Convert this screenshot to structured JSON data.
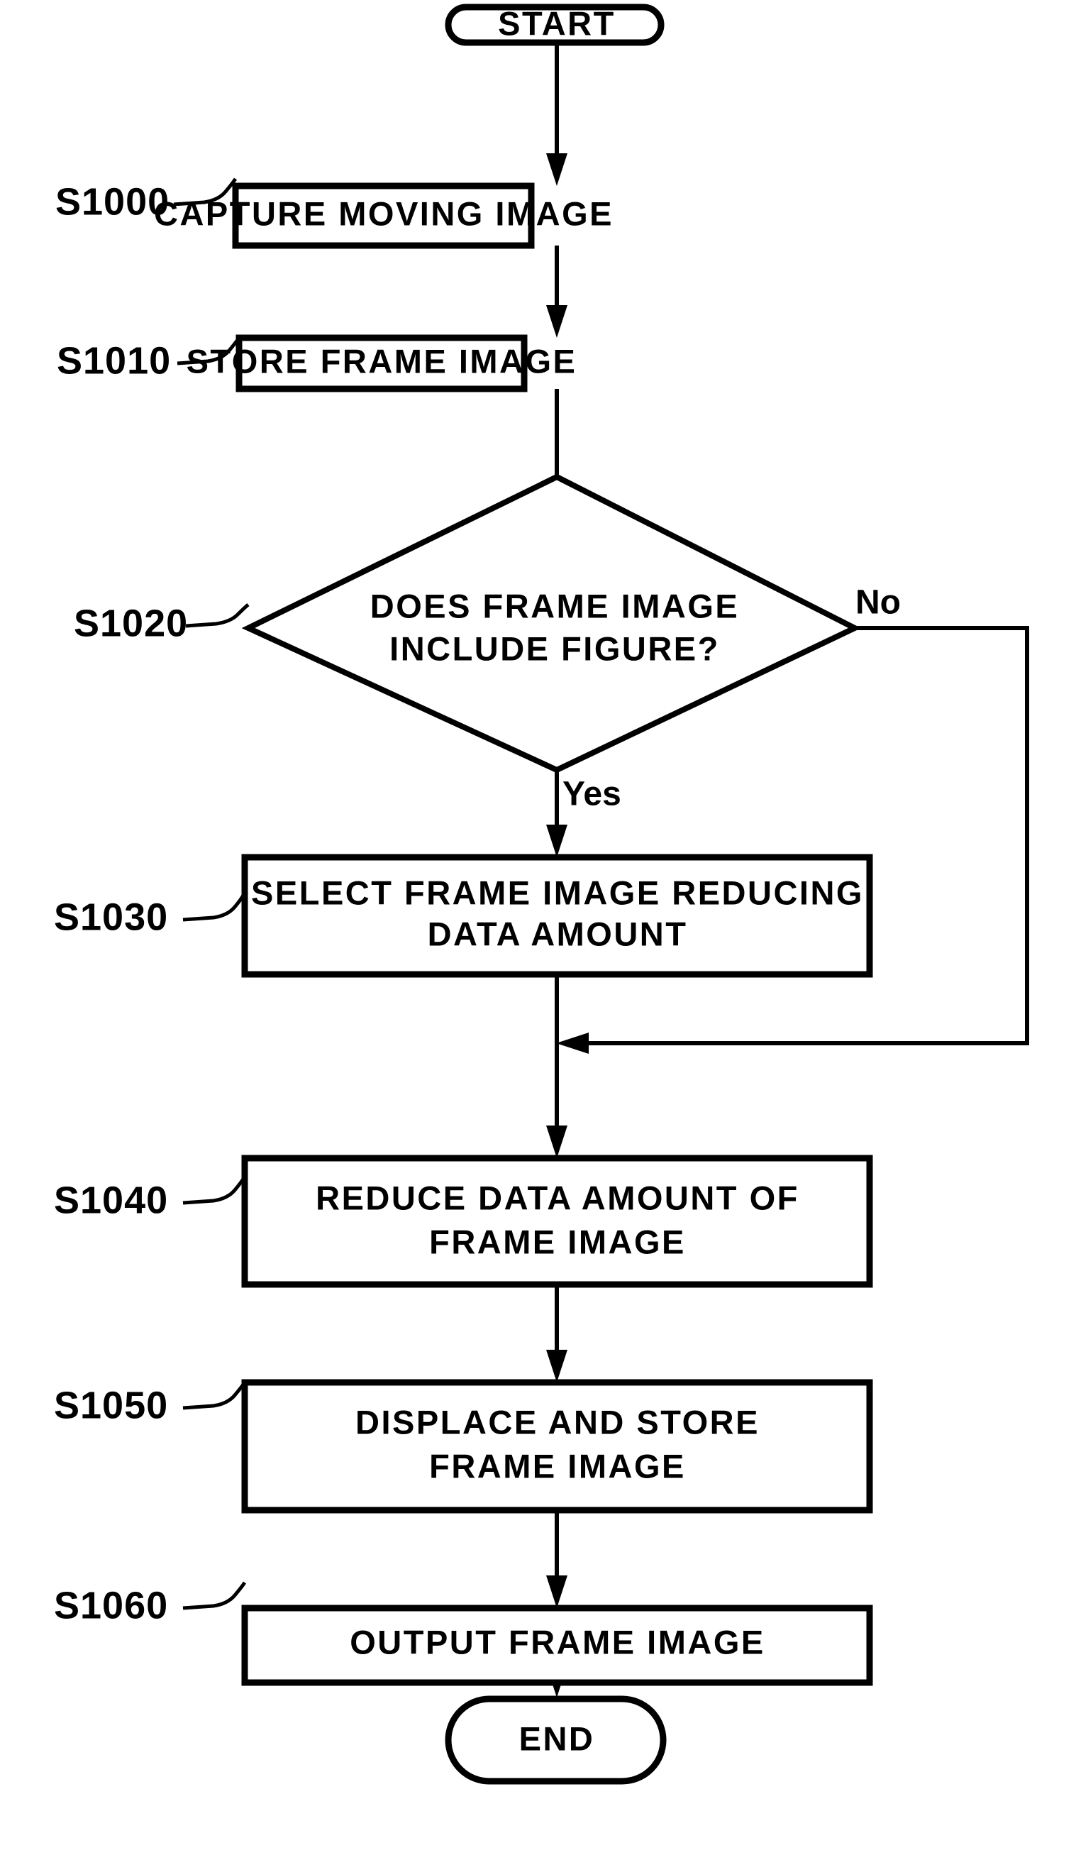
{
  "diagram": {
    "type": "flowchart",
    "title": "",
    "background_color": "#ffffff",
    "line_color": "#000000"
  },
  "nodes": {
    "start": {
      "shape": "terminator",
      "label": "START"
    },
    "s1000": {
      "shape": "process",
      "step_id": "S1000",
      "line1": "CAPTURE MOVING IMAGE",
      "line2": ""
    },
    "s1010": {
      "shape": "process",
      "step_id": "S1010",
      "line1": "STORE FRAME IMAGE",
      "line2": ""
    },
    "s1020": {
      "shape": "decision",
      "step_id": "S1020",
      "line1": "DOES FRAME IMAGE",
      "line2": "INCLUDE FIGURE?"
    },
    "s1030": {
      "shape": "process",
      "step_id": "S1030",
      "line1": "SELECT FRAME IMAGE REDUCING",
      "line2": "DATA AMOUNT"
    },
    "s1040": {
      "shape": "process",
      "step_id": "S1040",
      "line1": "REDUCE DATA AMOUNT OF",
      "line2": "FRAME IMAGE"
    },
    "s1050": {
      "shape": "process",
      "step_id": "S1050",
      "line1": "DISPLACE AND STORE",
      "line2": "FRAME IMAGE"
    },
    "s1060": {
      "shape": "process",
      "step_id": "S1060",
      "line1": "OUTPUT FRAME IMAGE",
      "line2": ""
    },
    "end": {
      "shape": "terminator",
      "label": "END"
    }
  },
  "branch_labels": {
    "no": "No",
    "yes": "Yes"
  }
}
